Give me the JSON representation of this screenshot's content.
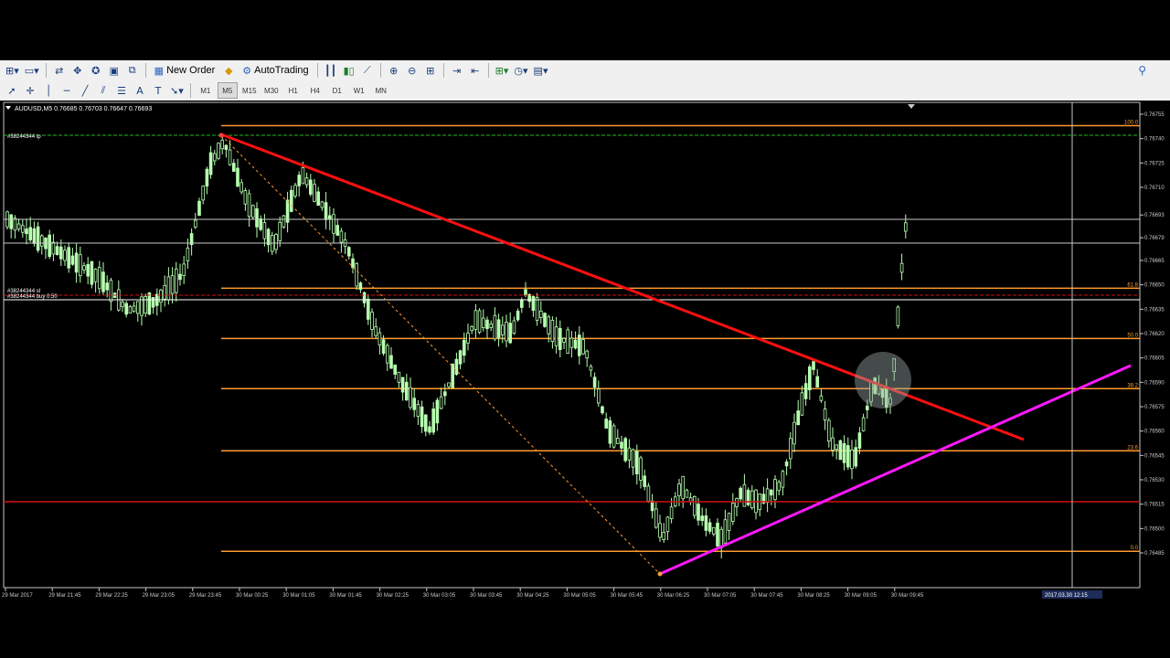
{
  "toolbar": {
    "new_order_label": "New Order",
    "autotrading_label": "AutoTrading",
    "timeframes": [
      "M1",
      "M5",
      "M15",
      "M30",
      "H1",
      "H4",
      "D1",
      "W1",
      "MN"
    ]
  },
  "chart": {
    "header": "AUDUSD,M5  0.76685 0.76703 0.76647 0.76693",
    "tp_label": "#38244344 tp",
    "sl_label": "#38244344 sl",
    "buy_label": "#38244344 buy 0.50",
    "cursor_time": "2017.03.30 12:15",
    "price_ticks": [
      "0.76755",
      "0.76740",
      "0.76725",
      "0.76710",
      "0.76693",
      "0.76679",
      "0.76665",
      "0.76650",
      "0.76635",
      "0.76620",
      "0.76605",
      "0.76590",
      "0.76575",
      "0.76560",
      "0.76545",
      "0.76530",
      "0.76515",
      "0.76500",
      "0.76485"
    ],
    "time_ticks": [
      "29 Mar 2017",
      "29 Mar 21:45",
      "29 Mar 22:25",
      "29 Mar 23:05",
      "29 Mar 23:45",
      "30 Mar 00:25",
      "30 Mar 01:05",
      "30 Mar 01:45",
      "30 Mar 02:25",
      "30 Mar 03:05",
      "30 Mar 03:45",
      "30 Mar 04:25",
      "30 Mar 05:05",
      "30 Mar 05:45",
      "30 Mar 06:25",
      "30 Mar 07:05",
      "30 Mar 07:45",
      "30 Mar 08:25",
      "30 Mar 09:05",
      "30 Mar 09:45"
    ],
    "fib_levels": [
      "100.0",
      "61.8",
      "50.0",
      "38.2",
      "23.6",
      "0.0"
    ],
    "colors": {
      "candle": "#b7ffb0",
      "fib": "#ff9a2e",
      "trend_red": "#ff1010",
      "trend_magenta": "#ff18ff",
      "tp_green": "#1dbb1d",
      "sl_red": "#d01010",
      "gridline": "#c8c8c8"
    }
  }
}
